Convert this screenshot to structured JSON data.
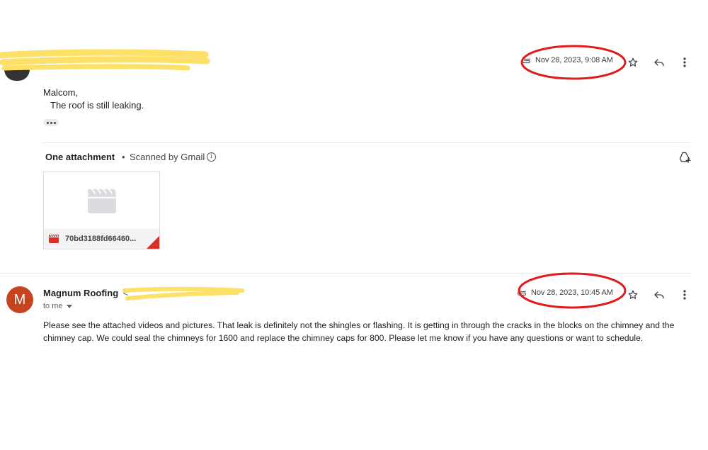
{
  "message1": {
    "greeting": "Malcom,",
    "body": "The roof is still leaking.",
    "date": "Nov 28, 2023, 9:08 AM"
  },
  "attachments": {
    "title": "One attachment",
    "separator": "•",
    "scanned": "Scanned by Gmail",
    "info_icon": "i",
    "file_name": "70bd3188fd66460..."
  },
  "message2": {
    "avatar_letter": "M",
    "sender": "Magnum Roofing",
    "sender_email_open": "<",
    "recipient": "to me",
    "date": "Nov 28, 2023, 10:45 AM",
    "body": "Please see the attached videos and pictures. That leak is definitely not the shingles or flashing. It is getting in through the cracks in the blocks on the chimney and the chimney cap. We could seal the chimneys for 1600 and replace the chimney caps for 800. Please let me know if you have any questions or want to schedule."
  },
  "colors": {
    "avatar_bg": "#c5431f",
    "highlight_circle": "#e01b1b",
    "redaction": "#fde068",
    "video_icon": "#d93025"
  },
  "icons": [
    "attachment-clip-icon",
    "star-icon",
    "reply-icon",
    "more-vert-icon",
    "add-to-drive-icon",
    "video-file-icon",
    "info-icon",
    "chevron-down-icon"
  ]
}
